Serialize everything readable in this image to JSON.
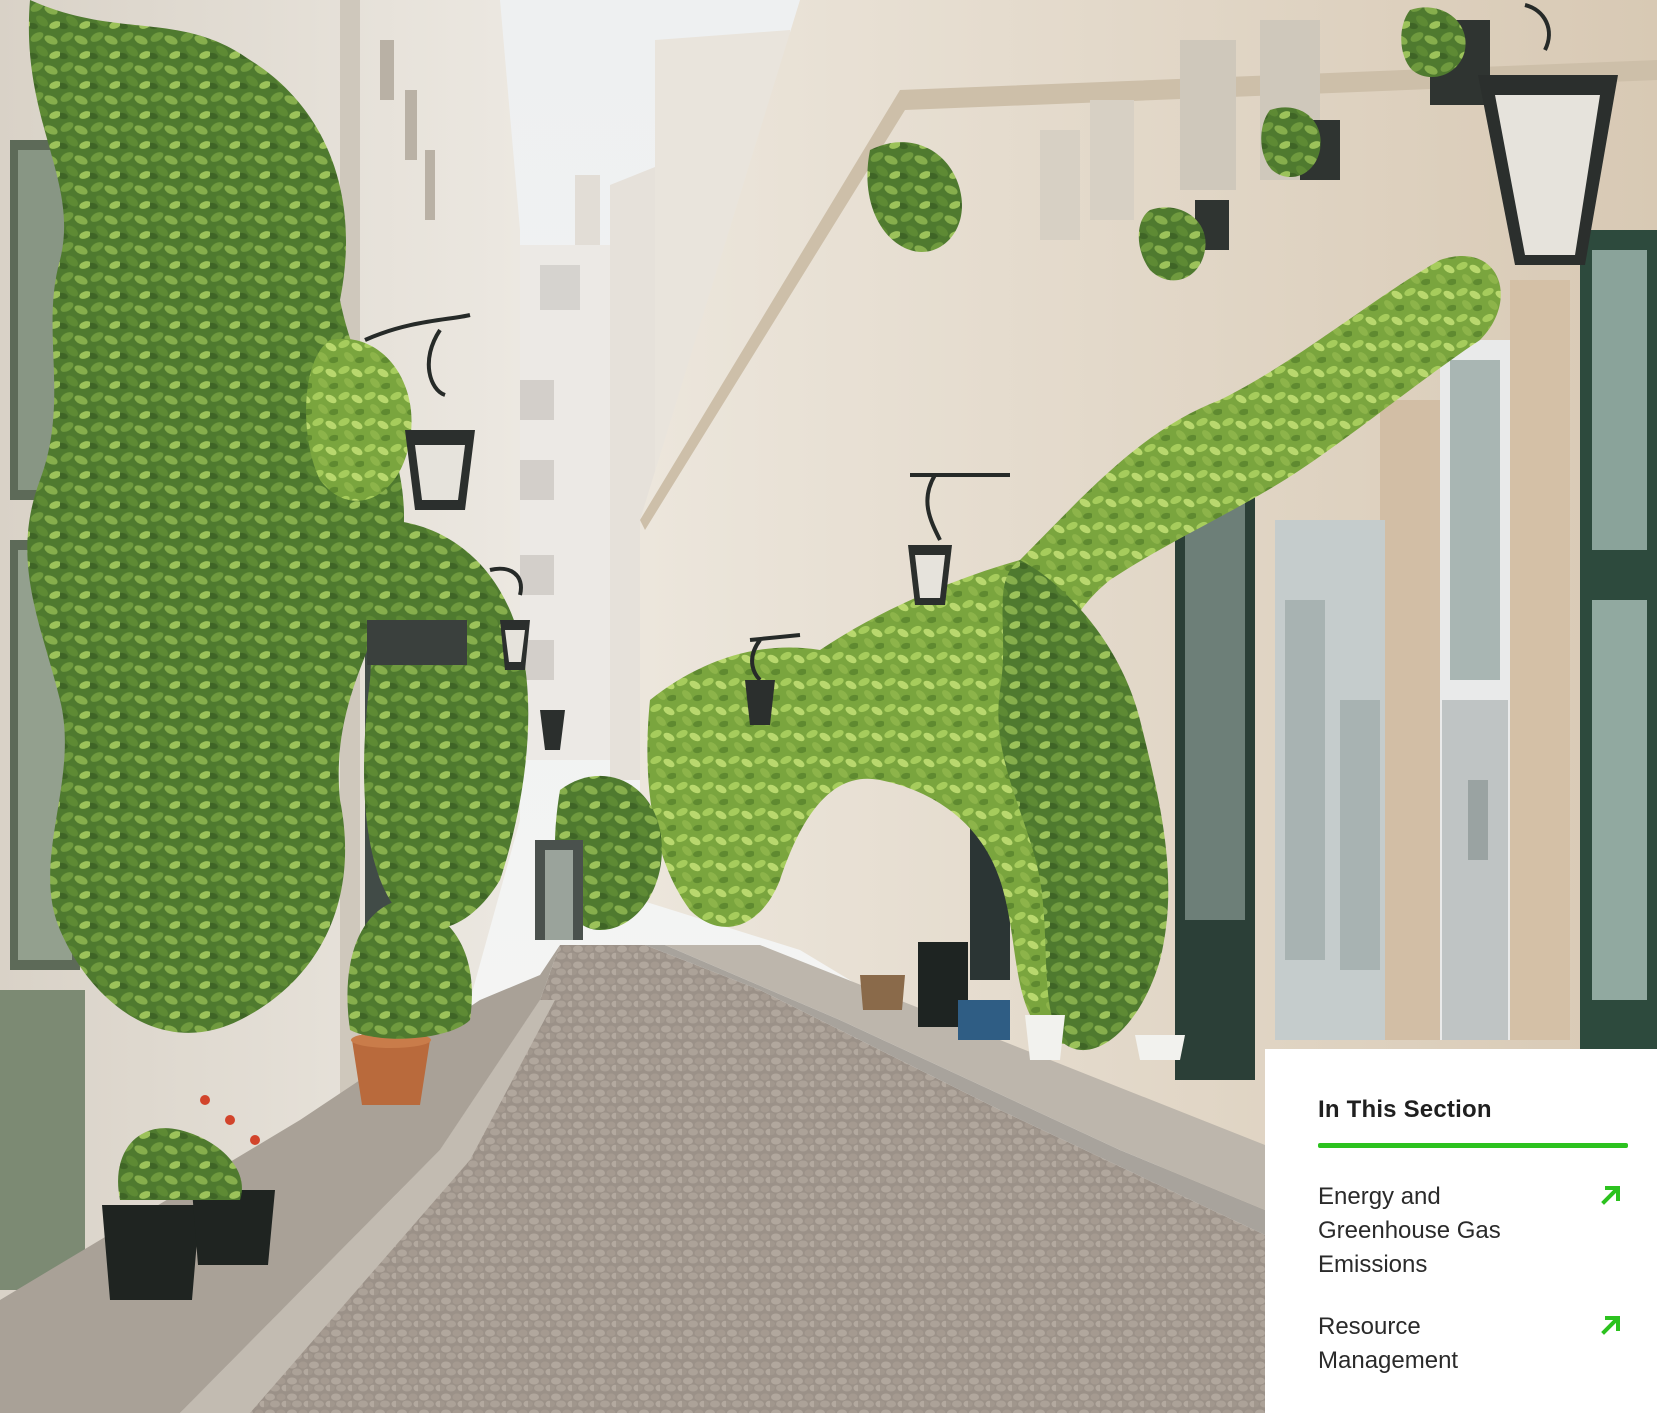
{
  "panel": {
    "title": "In This Section",
    "accent_color": "#2cc21f",
    "links": [
      {
        "label": "Energy and Greenhouse Gas Emissions",
        "icon": "arrow-up-right-icon"
      },
      {
        "label": "Resource Management",
        "icon": "arrow-up-right-icon"
      }
    ]
  }
}
